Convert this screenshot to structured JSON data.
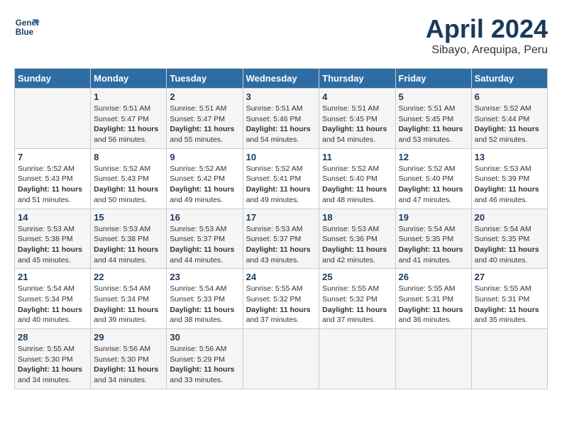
{
  "header": {
    "logo_line1": "General",
    "logo_line2": "Blue",
    "month": "April 2024",
    "location": "Sibayo, Arequipa, Peru"
  },
  "weekdays": [
    "Sunday",
    "Monday",
    "Tuesday",
    "Wednesday",
    "Thursday",
    "Friday",
    "Saturday"
  ],
  "weeks": [
    [
      {
        "day": "",
        "info": ""
      },
      {
        "day": "1",
        "info": "Sunrise: 5:51 AM\nSunset: 5:47 PM\nDaylight: 11 hours\nand 56 minutes."
      },
      {
        "day": "2",
        "info": "Sunrise: 5:51 AM\nSunset: 5:47 PM\nDaylight: 11 hours\nand 55 minutes."
      },
      {
        "day": "3",
        "info": "Sunrise: 5:51 AM\nSunset: 5:46 PM\nDaylight: 11 hours\nand 54 minutes."
      },
      {
        "day": "4",
        "info": "Sunrise: 5:51 AM\nSunset: 5:45 PM\nDaylight: 11 hours\nand 54 minutes."
      },
      {
        "day": "5",
        "info": "Sunrise: 5:51 AM\nSunset: 5:45 PM\nDaylight: 11 hours\nand 53 minutes."
      },
      {
        "day": "6",
        "info": "Sunrise: 5:52 AM\nSunset: 5:44 PM\nDaylight: 11 hours\nand 52 minutes."
      }
    ],
    [
      {
        "day": "7",
        "info": "Sunrise: 5:52 AM\nSunset: 5:43 PM\nDaylight: 11 hours\nand 51 minutes."
      },
      {
        "day": "8",
        "info": "Sunrise: 5:52 AM\nSunset: 5:43 PM\nDaylight: 11 hours\nand 50 minutes."
      },
      {
        "day": "9",
        "info": "Sunrise: 5:52 AM\nSunset: 5:42 PM\nDaylight: 11 hours\nand 49 minutes."
      },
      {
        "day": "10",
        "info": "Sunrise: 5:52 AM\nSunset: 5:41 PM\nDaylight: 11 hours\nand 49 minutes."
      },
      {
        "day": "11",
        "info": "Sunrise: 5:52 AM\nSunset: 5:40 PM\nDaylight: 11 hours\nand 48 minutes."
      },
      {
        "day": "12",
        "info": "Sunrise: 5:52 AM\nSunset: 5:40 PM\nDaylight: 11 hours\nand 47 minutes."
      },
      {
        "day": "13",
        "info": "Sunrise: 5:53 AM\nSunset: 5:39 PM\nDaylight: 11 hours\nand 46 minutes."
      }
    ],
    [
      {
        "day": "14",
        "info": "Sunrise: 5:53 AM\nSunset: 5:38 PM\nDaylight: 11 hours\nand 45 minutes."
      },
      {
        "day": "15",
        "info": "Sunrise: 5:53 AM\nSunset: 5:38 PM\nDaylight: 11 hours\nand 44 minutes."
      },
      {
        "day": "16",
        "info": "Sunrise: 5:53 AM\nSunset: 5:37 PM\nDaylight: 11 hours\nand 44 minutes."
      },
      {
        "day": "17",
        "info": "Sunrise: 5:53 AM\nSunset: 5:37 PM\nDaylight: 11 hours\nand 43 minutes."
      },
      {
        "day": "18",
        "info": "Sunrise: 5:53 AM\nSunset: 5:36 PM\nDaylight: 11 hours\nand 42 minutes."
      },
      {
        "day": "19",
        "info": "Sunrise: 5:54 AM\nSunset: 5:35 PM\nDaylight: 11 hours\nand 41 minutes."
      },
      {
        "day": "20",
        "info": "Sunrise: 5:54 AM\nSunset: 5:35 PM\nDaylight: 11 hours\nand 40 minutes."
      }
    ],
    [
      {
        "day": "21",
        "info": "Sunrise: 5:54 AM\nSunset: 5:34 PM\nDaylight: 11 hours\nand 40 minutes."
      },
      {
        "day": "22",
        "info": "Sunrise: 5:54 AM\nSunset: 5:34 PM\nDaylight: 11 hours\nand 39 minutes."
      },
      {
        "day": "23",
        "info": "Sunrise: 5:54 AM\nSunset: 5:33 PM\nDaylight: 11 hours\nand 38 minutes."
      },
      {
        "day": "24",
        "info": "Sunrise: 5:55 AM\nSunset: 5:32 PM\nDaylight: 11 hours\nand 37 minutes."
      },
      {
        "day": "25",
        "info": "Sunrise: 5:55 AM\nSunset: 5:32 PM\nDaylight: 11 hours\nand 37 minutes."
      },
      {
        "day": "26",
        "info": "Sunrise: 5:55 AM\nSunset: 5:31 PM\nDaylight: 11 hours\nand 36 minutes."
      },
      {
        "day": "27",
        "info": "Sunrise: 5:55 AM\nSunset: 5:31 PM\nDaylight: 11 hours\nand 35 minutes."
      }
    ],
    [
      {
        "day": "28",
        "info": "Sunrise: 5:55 AM\nSunset: 5:30 PM\nDaylight: 11 hours\nand 34 minutes."
      },
      {
        "day": "29",
        "info": "Sunrise: 5:56 AM\nSunset: 5:30 PM\nDaylight: 11 hours\nand 34 minutes."
      },
      {
        "day": "30",
        "info": "Sunrise: 5:56 AM\nSunset: 5:29 PM\nDaylight: 11 hours\nand 33 minutes."
      },
      {
        "day": "",
        "info": ""
      },
      {
        "day": "",
        "info": ""
      },
      {
        "day": "",
        "info": ""
      },
      {
        "day": "",
        "info": ""
      }
    ]
  ]
}
